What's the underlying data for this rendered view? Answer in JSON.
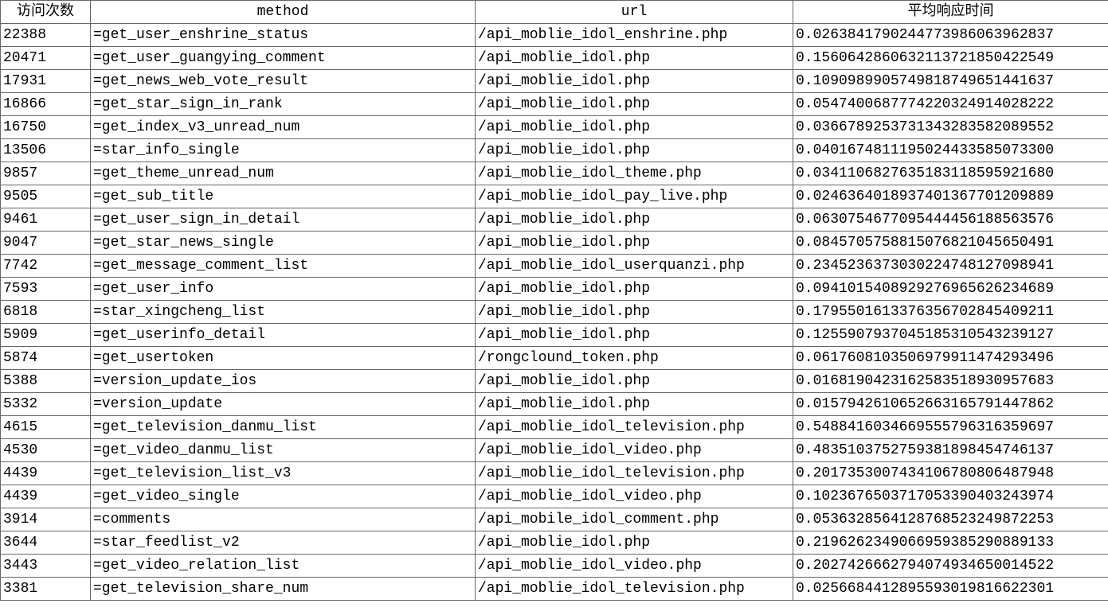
{
  "headers": {
    "count": "访问次数",
    "method": "method",
    "url": "url",
    "avg": "平均响应时间"
  },
  "rows": [
    {
      "count": "22388",
      "method": "=get_user_enshrine_status",
      "url": "/api_moblie_idol_enshrine.php",
      "avg": "0.0263841790244773986063962837"
    },
    {
      "count": "20471",
      "method": "=get_user_guangying_comment",
      "url": "/api_moblie_idol.php",
      "avg": "0.1560642860632113721850422549"
    },
    {
      "count": "17931",
      "method": "=get_news_web_vote_result",
      "url": "/api_moblie_idol.php",
      "avg": "0.1090989905749818749651441637"
    },
    {
      "count": "16866",
      "method": "=get_star_sign_in_rank",
      "url": "/api_moblie_idol.php",
      "avg": "0.0547400687774220324914028222"
    },
    {
      "count": "16750",
      "method": "=get_index_v3_unread_num",
      "url": "/api_moblie_idol.php",
      "avg": "0.0366789253731343283582089552"
    },
    {
      "count": "13506",
      "method": "=star_info_single",
      "url": "/api_moblie_idol.php",
      "avg": "0.0401674811195024433585073300"
    },
    {
      "count": "9857",
      "method": "=get_theme_unread_num",
      "url": "/api_moblie_idol_theme.php",
      "avg": "0.0341106827635183118595921680"
    },
    {
      "count": "9505",
      "method": "=get_sub_title",
      "url": "/api_moblie_idol_pay_live.php",
      "avg": "0.0246364018937401367701209889"
    },
    {
      "count": "9461",
      "method": "=get_user_sign_in_detail",
      "url": "/api_moblie_idol.php",
      "avg": "0.0630754677095444456188563576"
    },
    {
      "count": "9047",
      "method": "=get_star_news_single",
      "url": "/api_moblie_idol.php",
      "avg": "0.0845705758815076821045650491"
    },
    {
      "count": "7742",
      "method": "=get_message_comment_list",
      "url": "/api_moblie_idol_userquanzi.php",
      "avg": "0.2345236373030224748127098941"
    },
    {
      "count": "7593",
      "method": "=get_user_info",
      "url": "/api_moblie_idol.php",
      "avg": "0.0941015408929276965626234689"
    },
    {
      "count": "6818",
      "method": "=star_xingcheng_list",
      "url": "/api_moblie_idol.php",
      "avg": "0.1795501613376356702845409211"
    },
    {
      "count": "5909",
      "method": "=get_userinfo_detail",
      "url": "/api_moblie_idol.php",
      "avg": "0.1255907937045185310543239127"
    },
    {
      "count": "5874",
      "method": "=get_usertoken",
      "url": "/rongclound_token.php",
      "avg": "0.0617608103506979911474293496"
    },
    {
      "count": "5388",
      "method": "=version_update_ios",
      "url": "/api_moblie_idol.php",
      "avg": "0.0168190423162583518930957683"
    },
    {
      "count": "5332",
      "method": "=version_update",
      "url": "/api_moblie_idol.php",
      "avg": "0.0157942610652663165791447862"
    },
    {
      "count": "4615",
      "method": "=get_television_danmu_list",
      "url": "/api_moblie_idol_television.php",
      "avg": "0.5488416034669555796316359697"
    },
    {
      "count": "4530",
      "method": "=get_video_danmu_list",
      "url": "/api_moblie_idol_video.php",
      "avg": "0.4835103752759381898454746137"
    },
    {
      "count": "4439",
      "method": "=get_television_list_v3",
      "url": "/api_moblie_idol_television.php",
      "avg": "0.2017353007434106780806487948"
    },
    {
      "count": "4439",
      "method": "=get_video_single",
      "url": "/api_moblie_idol_video.php",
      "avg": "0.1023676503717053390403243974"
    },
    {
      "count": "3914",
      "method": "=comments",
      "url": "/api_mobile_idol_comment.php",
      "avg": "0.0536328564128768523249872253"
    },
    {
      "count": "3644",
      "method": "=star_feedlist_v2",
      "url": "/api_moblie_idol.php",
      "avg": "0.2196262349066959385290889133"
    },
    {
      "count": "3443",
      "method": "=get_video_relation_list",
      "url": "/api_moblie_idol_video.php",
      "avg": "0.2027426662794074934650014522"
    },
    {
      "count": "3381",
      "method": "=get_television_share_num",
      "url": "/api_moblie_idol_television.php",
      "avg": "0.0256684412895593019816622301"
    }
  ]
}
